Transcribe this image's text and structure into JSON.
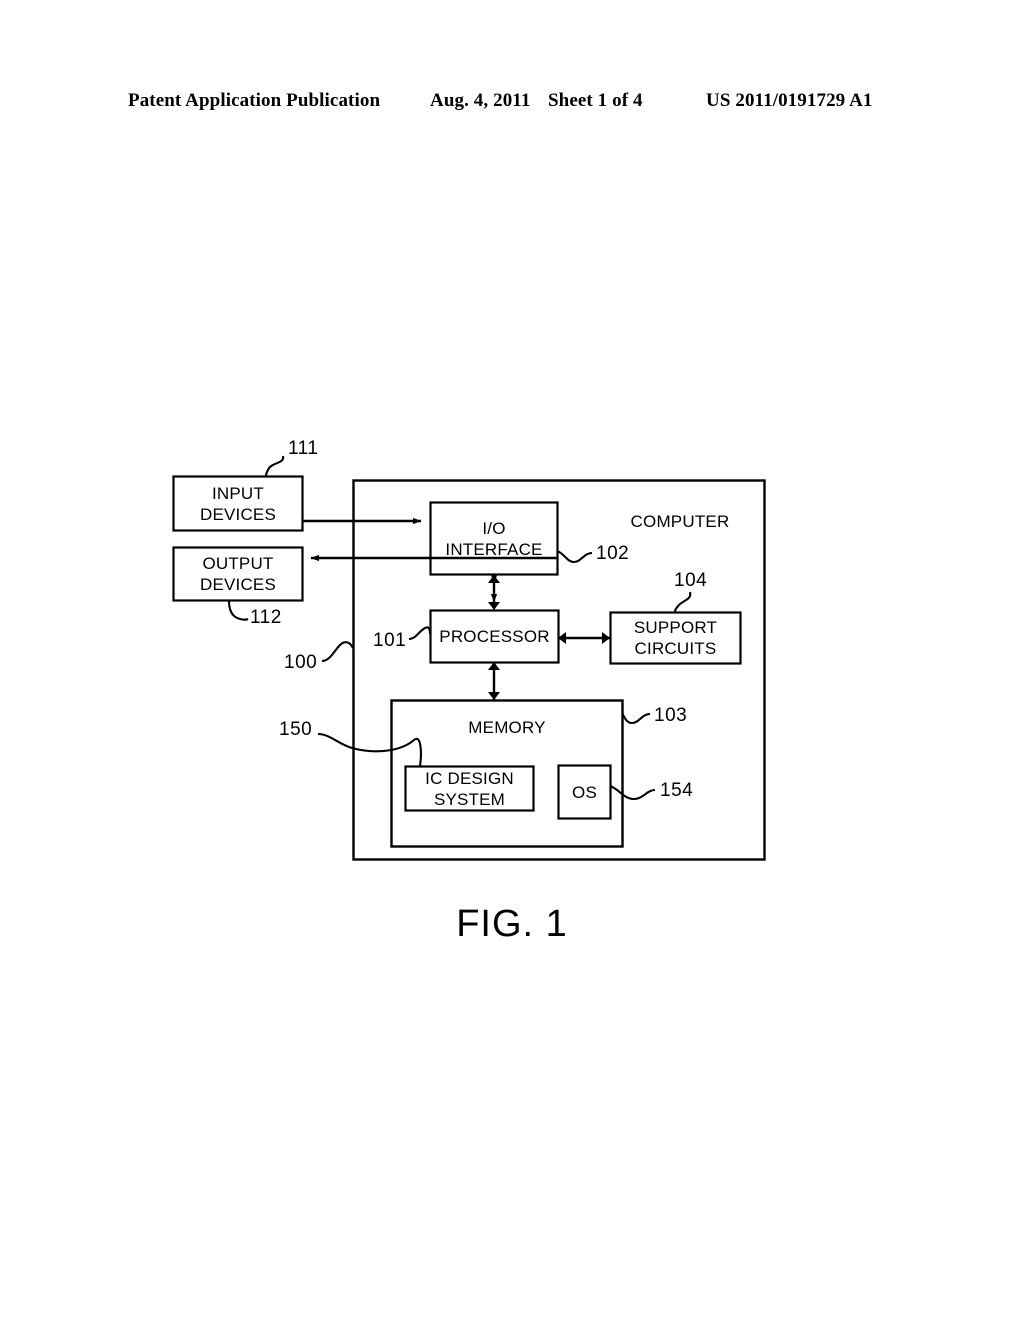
{
  "header": {
    "publication": "Patent Application Publication",
    "date": "Aug. 4, 2011",
    "sheet": "Sheet 1 of 4",
    "patent_number": "US 2011/0191729 A1"
  },
  "figure": {
    "caption": "FIG. 1",
    "boxes": {
      "input_devices": "INPUT\nDEVICES",
      "output_devices": "OUTPUT\nDEVICES",
      "io_interface": "I/O\nINTERFACE",
      "processor": "PROCESSOR",
      "support_circuits": "SUPPORT\nCIRCUITS",
      "memory": "MEMORY",
      "ic_design_system": "IC DESIGN\nSYSTEM",
      "os": "OS",
      "computer": "COMPUTER"
    },
    "reference_numerals": {
      "computer": "100",
      "processor": "101",
      "io_interface": "102",
      "memory": "103",
      "support_circuits": "104",
      "input_devices": "111",
      "output_devices": "112",
      "ic_design_system": "150",
      "os": "154"
    },
    "colors": {
      "line": "#000000",
      "background": "#ffffff"
    }
  }
}
